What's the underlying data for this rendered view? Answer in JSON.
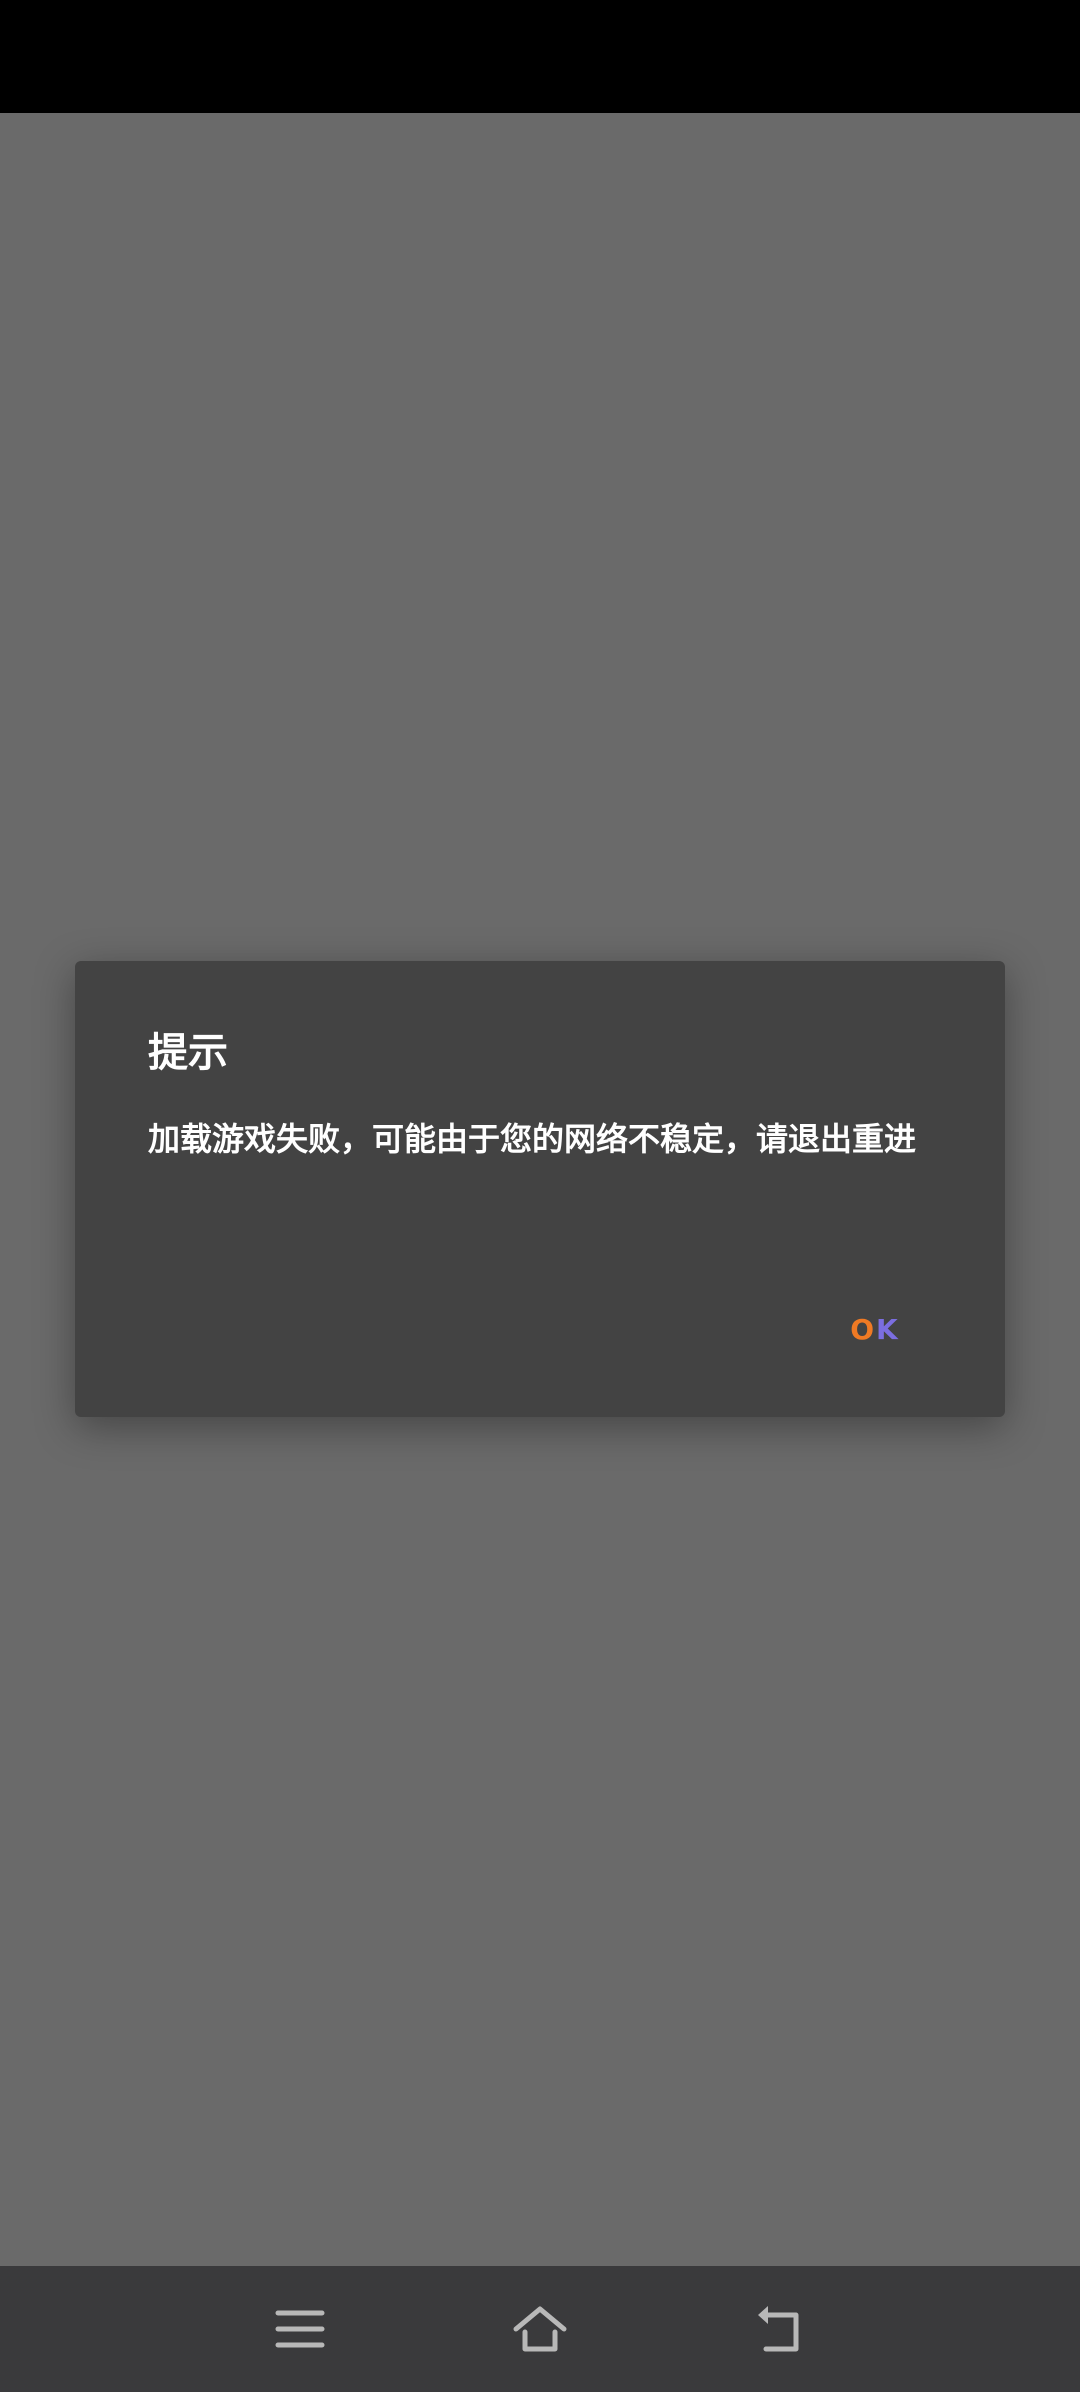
{
  "dialog": {
    "title": "提示",
    "message": "加载游戏失败，可能由于您的网络不稳定，请退出重进",
    "ok_label_o": "O",
    "ok_label_k": "K"
  },
  "nav": {
    "menu_icon": "menu-icon",
    "home_icon": "home-icon",
    "back_icon": "back-icon"
  },
  "colors": {
    "backdrop": "#6a6a6a",
    "dialog_bg": "#434343",
    "accent_orange": "#f07a24",
    "accent_purple": "#7b6ee0",
    "nav_bg": "#3a3a3c"
  }
}
